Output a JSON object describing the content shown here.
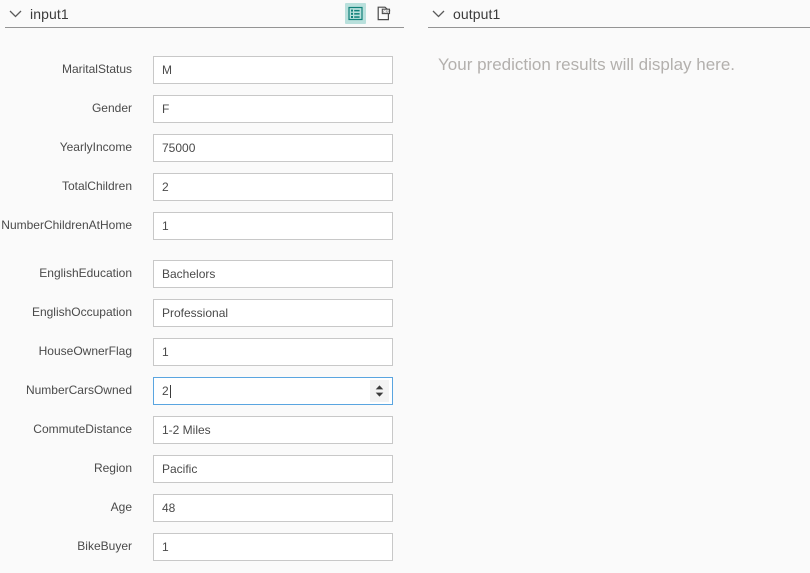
{
  "accent_color": "#00796b",
  "focus_color": "#5aa5e0",
  "input_panel": {
    "title": "input1",
    "chevron_icon": "chevron-down-icon",
    "actions": [
      {
        "icon": "form-view-icon",
        "active": true
      },
      {
        "icon": "csv-file-icon",
        "active": false
      }
    ],
    "fields": [
      {
        "label": "MaritalStatus",
        "value": "M",
        "type": "text",
        "focused": false
      },
      {
        "label": "Gender",
        "value": "F",
        "type": "text",
        "focused": false
      },
      {
        "label": "YearlyIncome",
        "value": "75000",
        "type": "text",
        "focused": false
      },
      {
        "label": "TotalChildren",
        "value": "2",
        "type": "text",
        "focused": false
      },
      {
        "label": "NumberChildrenAtHome",
        "value": "1",
        "type": "text",
        "focused": false
      },
      {
        "label": "EnglishEducation",
        "value": "Bachelors",
        "type": "text",
        "focused": false
      },
      {
        "label": "EnglishOccupation",
        "value": "Professional",
        "type": "text",
        "focused": false
      },
      {
        "label": "HouseOwnerFlag",
        "value": "1",
        "type": "text",
        "focused": false
      },
      {
        "label": "NumberCarsOwned",
        "value": "2",
        "type": "number",
        "focused": true
      },
      {
        "label": "CommuteDistance",
        "value": "1-2 Miles",
        "type": "text",
        "focused": false
      },
      {
        "label": "Region",
        "value": "Pacific",
        "type": "text",
        "focused": false
      },
      {
        "label": "Age",
        "value": "48",
        "type": "text",
        "focused": false
      },
      {
        "label": "BikeBuyer",
        "value": "1",
        "type": "text",
        "focused": false
      }
    ]
  },
  "output_panel": {
    "title": "output1",
    "chevron_icon": "chevron-down-icon",
    "placeholder": "Your prediction results will display here."
  }
}
